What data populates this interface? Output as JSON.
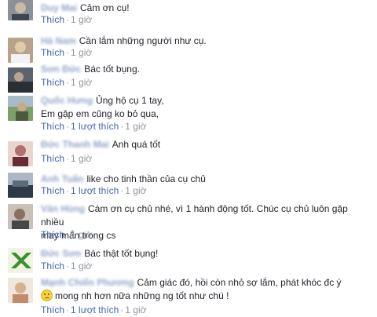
{
  "actions": {
    "like_label": "Thích"
  },
  "comments": [
    {
      "author": "Duy Mai",
      "text": "Cảm ơn cụ!",
      "time": "1 giờ",
      "avatar_color": "#7a7f86"
    },
    {
      "author": "Hà Nam",
      "text": "Cần lắm những người như cụ.",
      "time": "1 giờ",
      "avatar_color": "#a08672"
    },
    {
      "author": "Sơn Đức",
      "text": "Bác tốt bụng.",
      "time": "1 giờ",
      "avatar_color": "#4f5660"
    },
    {
      "author": "Quốc Hưng",
      "text_line1": "Ủng hộ cụ 1 tay,",
      "text_line2": "Em gặp em cũng ko bỏ qua,",
      "likes": "1 lượt thích",
      "time": "1 giờ",
      "avatar_color": "#6b8a5a"
    },
    {
      "author": "Đức Thanh Mai",
      "text": "Anh quá tốt",
      "time": "1 giờ",
      "avatar_color": "#b98a8a"
    },
    {
      "author": "Anh Tuấn",
      "text": "like cho tinh thần của cụ chủ",
      "likes": "1 lượt thích",
      "time": "1 giờ",
      "avatar_color": "#5f6c7a"
    },
    {
      "author": "Văn Hùng",
      "text_line1": "Cám ơn cụ chủ nhé, vì 1 hành động tốt. Chúc cụ chủ luôn gặp nhiều",
      "text_line2": "may mắn trong cs",
      "time": "1 giờ",
      "avatar_color": "#8d7f75"
    },
    {
      "author": "Đức Sơn",
      "text": "Bác thật tốt bụng!",
      "time": "1 giờ",
      "avatar_color": "#3f8a3f"
    },
    {
      "author": "Mạnh Chiến Phương",
      "text_line1": "Cảm giác đó, hồi còn nhỏ sợ lắm, phát khóc đc ý",
      "text_line2": "mong nh hơn nữa những ng tốt như chú !",
      "likes": "1 lượt thích",
      "time": "1 giờ",
      "avatar_color": "#d8b8a0"
    }
  ]
}
